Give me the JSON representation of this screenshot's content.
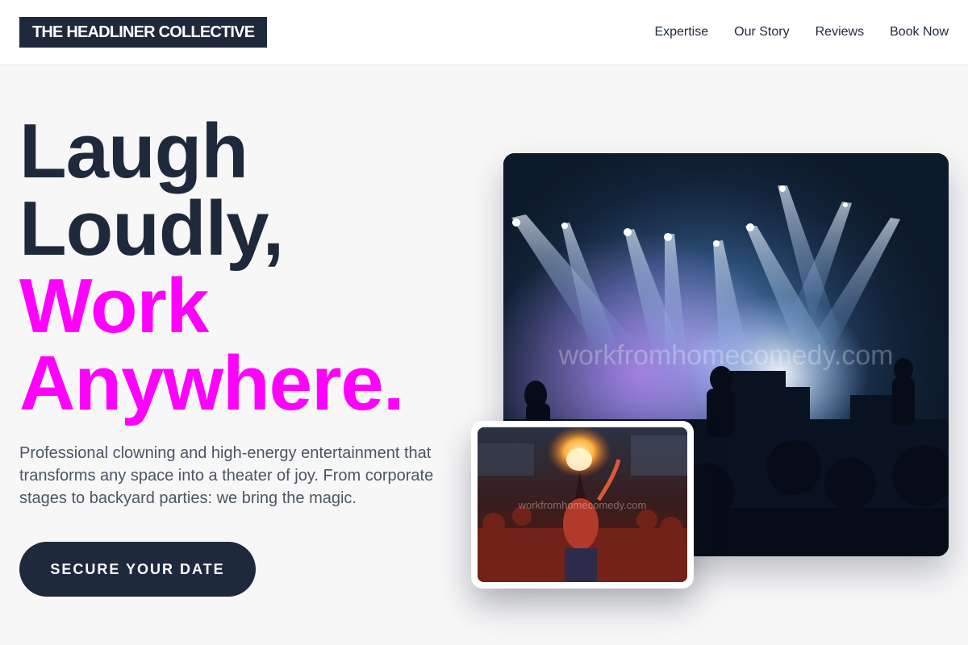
{
  "header": {
    "logo": "THE HEADLINER COLLECTIVE",
    "nav": [
      {
        "label": "Expertise"
      },
      {
        "label": "Our Story"
      },
      {
        "label": "Reviews"
      },
      {
        "label": "Book Now"
      }
    ]
  },
  "hero": {
    "headline_lines": [
      "Laugh",
      "Loudly,",
      "Work",
      "Anywhere."
    ],
    "lead": "Professional clowning and high-energy entertainment that transforms any space into a theater of joy. From corporate stages to backyard parties: we bring the magic.",
    "cta": "SECURE YOUR DATE"
  },
  "images": {
    "main_watermark": "workfromhomecomedy.com",
    "thumb_watermark": "workfromhomecomedy.com"
  },
  "colors": {
    "dark": "#1e293b",
    "accent": "#ff00ff",
    "page_bg": "#f7f7f8"
  }
}
